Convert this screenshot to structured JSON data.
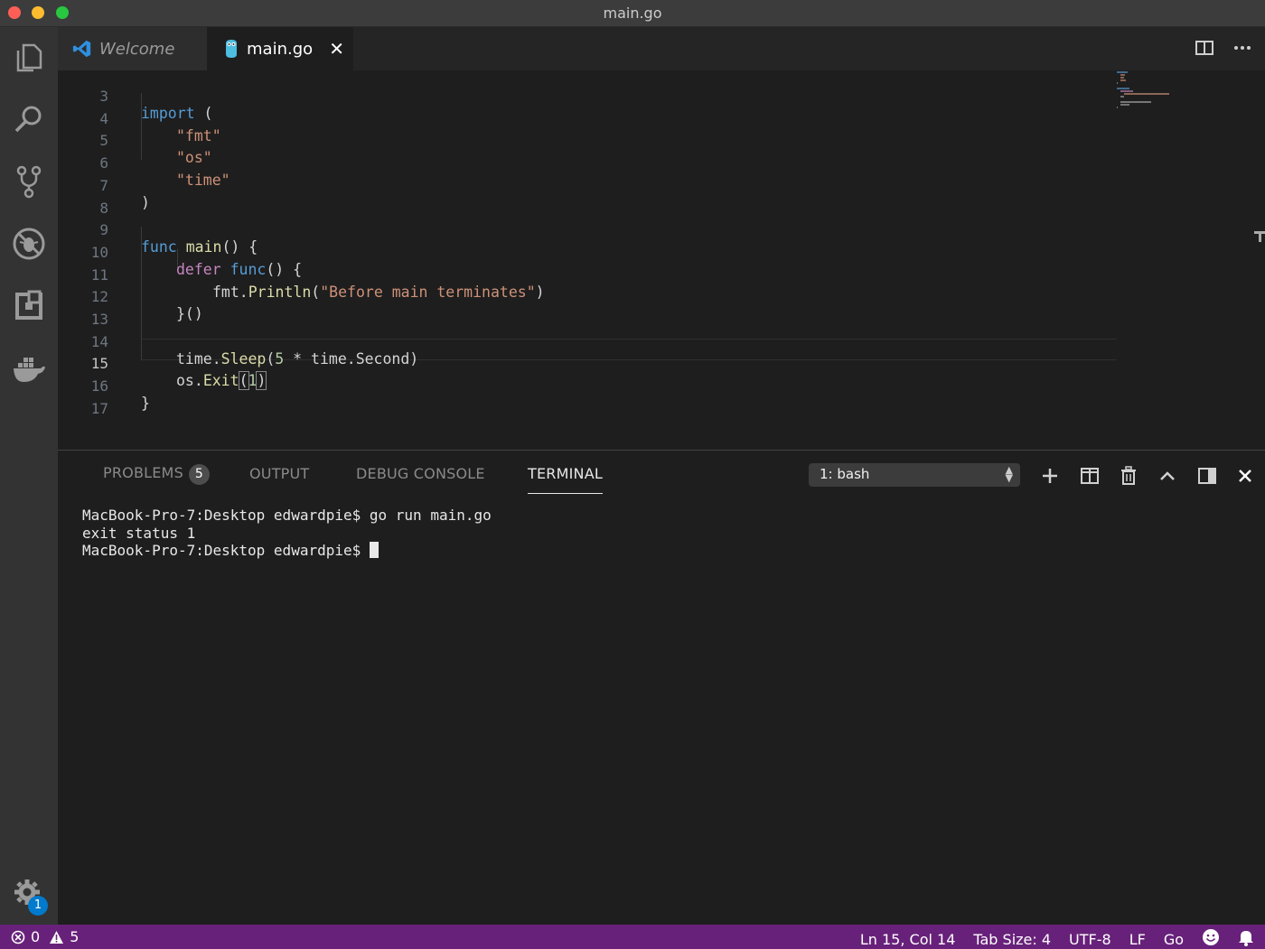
{
  "window": {
    "title": "main.go"
  },
  "activity_bar": {
    "items": [
      {
        "name": "explorer-icon"
      },
      {
        "name": "search-icon"
      },
      {
        "name": "source-control-icon"
      },
      {
        "name": "debug-icon"
      },
      {
        "name": "extensions-icon"
      },
      {
        "name": "docker-icon"
      }
    ],
    "settings_badge": "1"
  },
  "tabs": [
    {
      "label": "Welcome",
      "icon": "vscode-icon",
      "active": false
    },
    {
      "label": "main.go",
      "icon": "go-gopher-icon",
      "active": true,
      "close": "✕"
    }
  ],
  "editor": {
    "active_line": 15,
    "lines": [
      {
        "n": "3"
      },
      {
        "n": "4"
      },
      {
        "n": "5"
      },
      {
        "n": "6"
      },
      {
        "n": "7"
      },
      {
        "n": "8"
      },
      {
        "n": "9"
      },
      {
        "n": "10"
      },
      {
        "n": "11"
      },
      {
        "n": "12"
      },
      {
        "n": "13"
      },
      {
        "n": "14"
      },
      {
        "n": "15"
      },
      {
        "n": "16"
      },
      {
        "n": "17"
      }
    ],
    "tokens": {
      "import": "import",
      "paren_open": " (",
      "paren_close": ")",
      "fmt": "\"fmt\"",
      "os": "\"os\"",
      "time": "\"time\"",
      "func": "func",
      "main": "main",
      "main_rest": "() {",
      "defer": "defer",
      "func2": "func",
      "func2_rest": "() {",
      "fmt_obj": "fmt.",
      "println": "Println",
      "println_open": "(",
      "msg": "\"Before main terminates\"",
      "println_close": ")",
      "close_iife": "}()",
      "time_obj": "time.",
      "sleep": "Sleep",
      "sleep_open": "(",
      "five": "5",
      "sleep_rest": " * time.Second)",
      "os_obj": "os.",
      "exit": "Exit",
      "exit_open": "(",
      "one": "1",
      "exit_close": ")",
      "brace_close": "}"
    }
  },
  "panel": {
    "tabs": [
      {
        "label": "PROBLEMS",
        "badge": "5"
      },
      {
        "label": "OUTPUT"
      },
      {
        "label": "DEBUG CONSOLE"
      },
      {
        "label": "TERMINAL",
        "active": true
      }
    ],
    "terminal_selector": "1: bash",
    "terminal_lines": [
      "MacBook-Pro-7:Desktop edwardpie$ go run main.go",
      "exit status 1",
      "MacBook-Pro-7:Desktop edwardpie$ "
    ]
  },
  "statusbar": {
    "errors": "0",
    "warnings": "5",
    "position": "Ln 15, Col 14",
    "tab_size": "Tab Size: 4",
    "encoding": "UTF-8",
    "eol": "LF",
    "language": "Go"
  }
}
